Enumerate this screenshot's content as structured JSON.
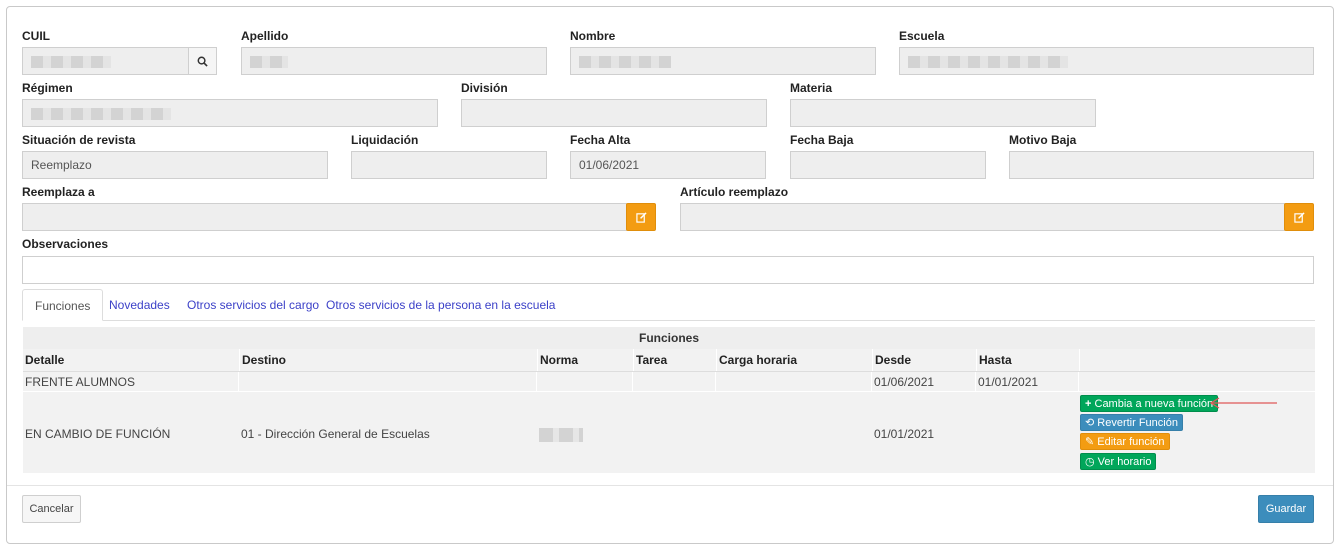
{
  "form": {
    "cuil": {
      "label": "CUIL",
      "value": ""
    },
    "apellido": {
      "label": "Apellido",
      "value": ""
    },
    "nombre": {
      "label": "Nombre",
      "value": ""
    },
    "escuela": {
      "label": "Escuela",
      "value": ""
    },
    "regimen": {
      "label": "Régimen",
      "value": ""
    },
    "division": {
      "label": "División",
      "value": ""
    },
    "materia": {
      "label": "Materia",
      "value": ""
    },
    "situacion": {
      "label": "Situación de revista",
      "value": "Reemplazo"
    },
    "liquidacion": {
      "label": "Liquidación",
      "value": ""
    },
    "fecha_alta": {
      "label": "Fecha Alta",
      "value": "01/06/2021"
    },
    "fecha_baja": {
      "label": "Fecha Baja",
      "value": ""
    },
    "motivo_baja": {
      "label": "Motivo Baja",
      "value": ""
    },
    "reemplaza_a": {
      "label": "Reemplaza a",
      "value": ""
    },
    "articulo_reemplazo": {
      "label": "Artículo reemplazo",
      "value": ""
    },
    "observaciones": {
      "label": "Observaciones",
      "value": ""
    }
  },
  "tabs": [
    {
      "label": "Funciones",
      "active": true
    },
    {
      "label": "Novedades",
      "active": false
    },
    {
      "label": "Otros servicios del cargo",
      "active": false
    },
    {
      "label": "Otros servicios de la persona en la escuela",
      "active": false
    }
  ],
  "table": {
    "title": "Funciones",
    "headers": [
      "Detalle",
      "Destino",
      "Norma",
      "Tarea",
      "Carga horaria",
      "Desde",
      "Hasta",
      ""
    ],
    "rows": [
      {
        "detalle": "FRENTE ALUMNOS",
        "destino": "",
        "norma": "",
        "tarea": "",
        "carga": "",
        "desde": "01/06/2021",
        "hasta": "01/01/2021"
      },
      {
        "detalle": "EN CAMBIO DE FUNCIÓN",
        "destino": "01 - Dirección General de Escuelas",
        "norma": "",
        "tarea": "",
        "carga": "",
        "desde": "01/01/2021",
        "hasta": ""
      }
    ],
    "actions": {
      "cambia": "Cambia a nueva función",
      "revertir": "Revertir Función",
      "editar": "Editar función",
      "horario": "Ver horario"
    }
  },
  "footer": {
    "cancel": "Cancelar",
    "save": "Guardar"
  },
  "icons": {
    "search": "search-icon",
    "edit": "edit-icon",
    "plus": "plus-icon",
    "undo": "undo-icon",
    "clock": "clock-icon",
    "arrow": "arrow-left-icon"
  },
  "colors": {
    "green": "#00a65a",
    "blue": "#3c8dbc",
    "orange": "#f39c12"
  }
}
